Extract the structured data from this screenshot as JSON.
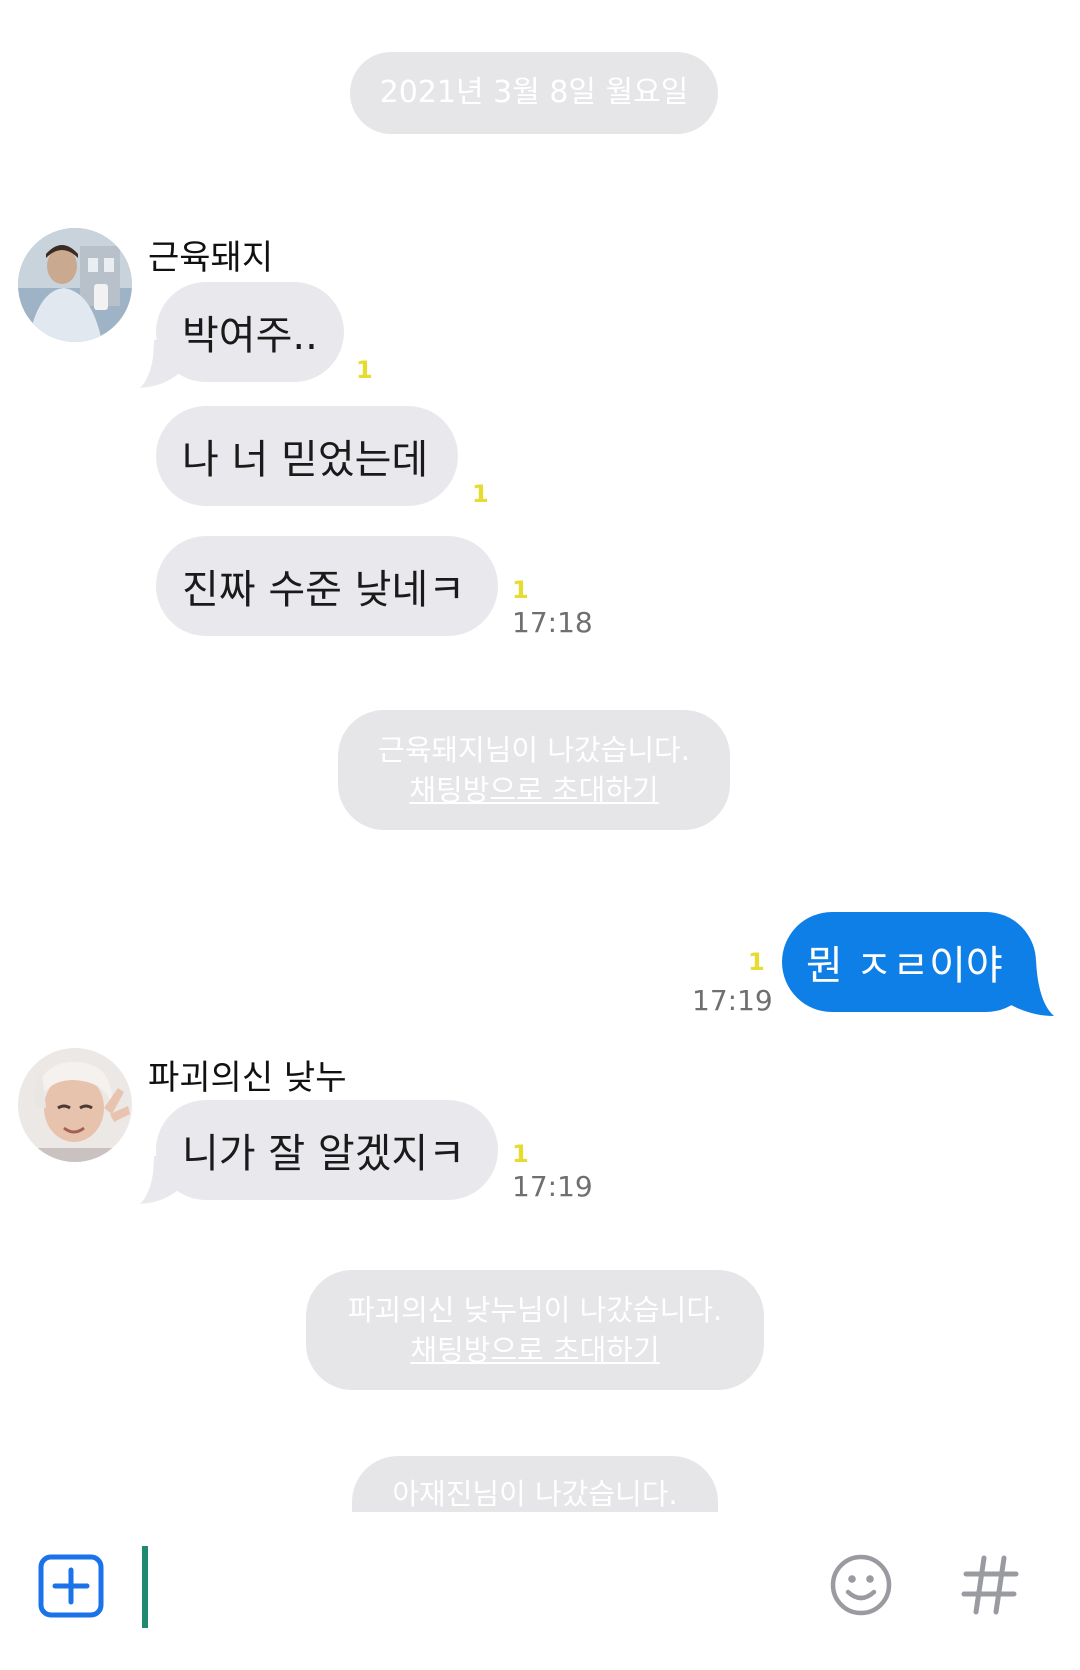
{
  "chat": {
    "date_label": "2021년 3월 8일 월요일",
    "messages": [
      {
        "sender": "근육돼지",
        "bubbles": [
          {
            "text": "박여주..",
            "unread": "1"
          },
          {
            "text": "나 너 믿었는데",
            "unread": "1"
          },
          {
            "text": "진짜 수준 낮네ㅋ",
            "unread": "1",
            "time": "17:18"
          }
        ]
      },
      {
        "system": "근육돼지님이 나갔습니다.",
        "invite": "채팅방으로 초대하기"
      },
      {
        "sender": "me",
        "bubbles": [
          {
            "text": "뭔 ㅈㄹ이야",
            "unread": "1",
            "time": "17:19"
          }
        ]
      },
      {
        "sender": "파괴의신 낮누",
        "bubbles": [
          {
            "text": "니가 잘 알겠지ㅋ",
            "unread": "1",
            "time": "17:19"
          }
        ]
      },
      {
        "system": "파괴의신 낮누님이 나갔습니다.",
        "invite": "채팅방으로 초대하기"
      },
      {
        "system": "아재진님이 나갔습니다."
      }
    ]
  },
  "colors": {
    "my_bubble": "#0f7fe8",
    "other_bubble": "#e9e9ed",
    "unread": "#e6dc30",
    "system_pill": "#e6e6e9",
    "cursor": "#1f8a70",
    "add_button": "#1a73e8"
  },
  "input_bar": {
    "icons": [
      "plus-box-icon",
      "emoji-icon",
      "hashtag-icon"
    ]
  }
}
